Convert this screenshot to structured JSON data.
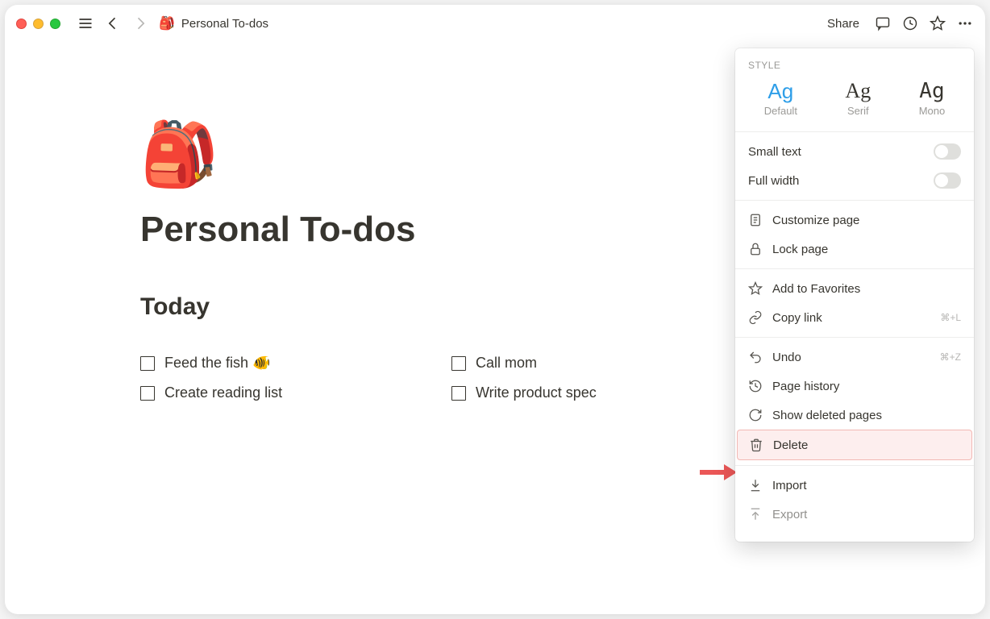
{
  "titlebar": {
    "page_icon": "🎒",
    "page_name": "Personal To-dos",
    "share": "Share"
  },
  "page": {
    "emoji": "🎒",
    "title": "Personal To-dos",
    "section": "Today",
    "col1": [
      {
        "text": "Feed the fish 🐠"
      },
      {
        "text": "Create reading list"
      }
    ],
    "col2": [
      {
        "text": "Call mom"
      },
      {
        "text": "Write product spec"
      }
    ]
  },
  "panel": {
    "style_label": "STYLE",
    "styles": {
      "default": "Default",
      "serif": "Serif",
      "mono": "Mono",
      "sample": "Ag"
    },
    "toggles": {
      "small_text": "Small text",
      "full_width": "Full width"
    },
    "items": {
      "customize": "Customize page",
      "lock": "Lock page",
      "favorites": "Add to Favorites",
      "copy_link": "Copy link",
      "copy_link_kbd": "⌘+L",
      "undo": "Undo",
      "undo_kbd": "⌘+Z",
      "history": "Page history",
      "deleted": "Show deleted pages",
      "delete": "Delete",
      "import": "Import",
      "export": "Export"
    }
  }
}
